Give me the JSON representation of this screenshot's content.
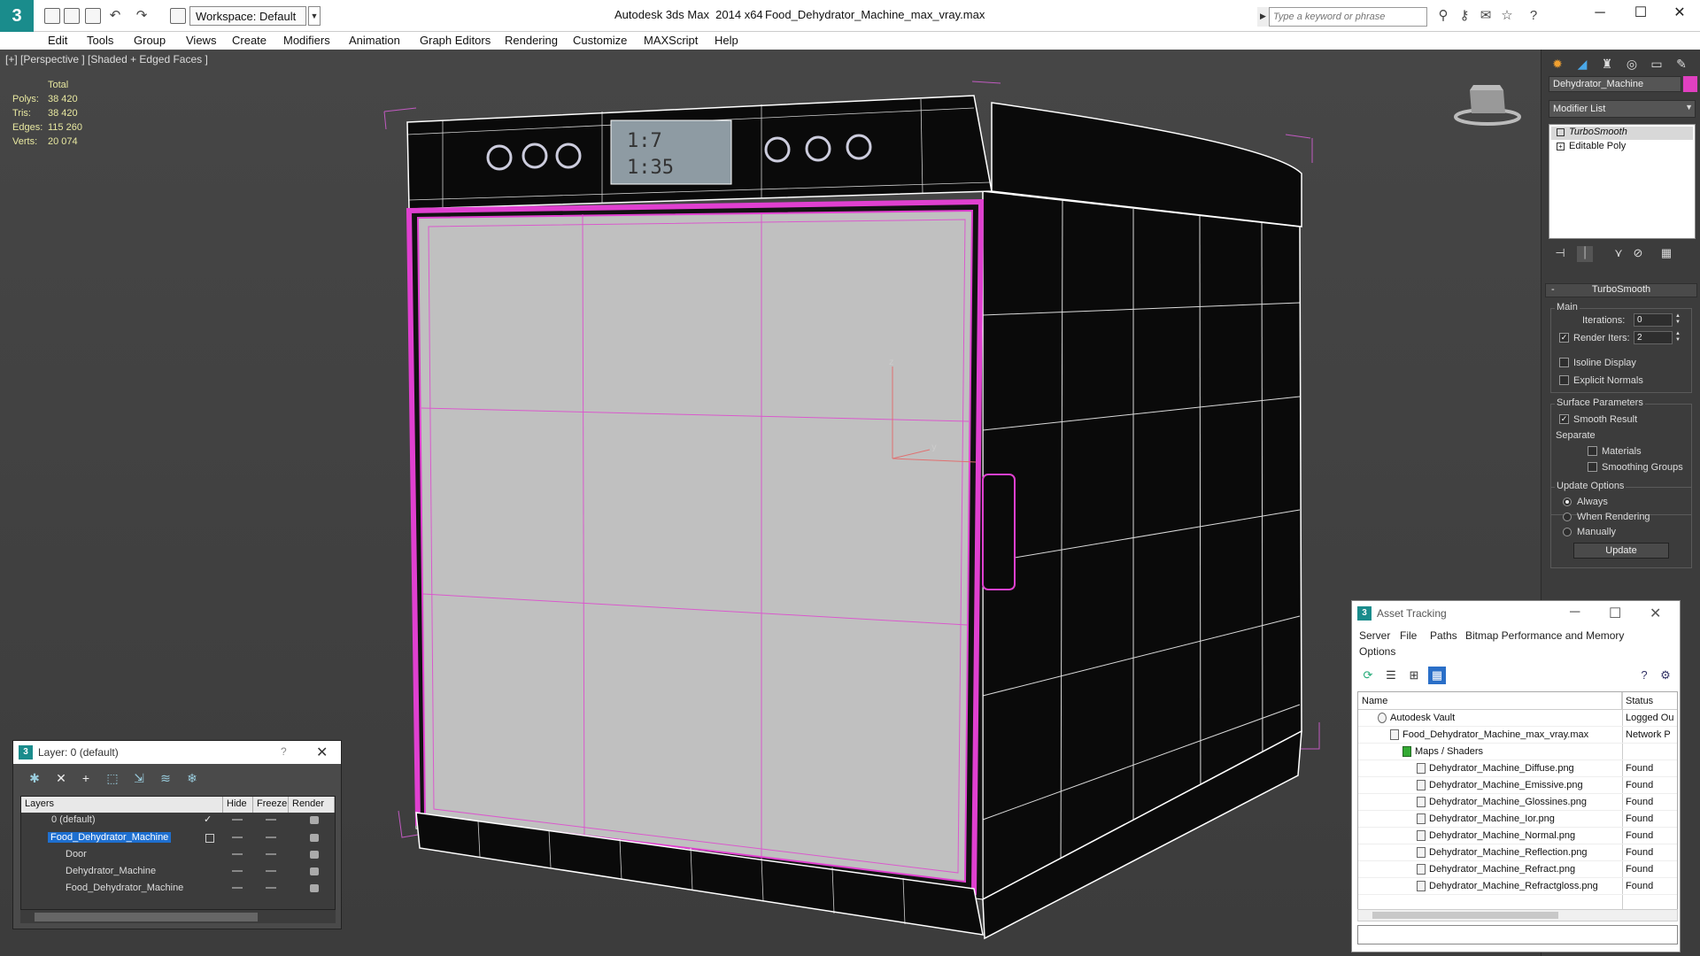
{
  "titlebar": {
    "workspace": "Workspace: Default",
    "app_title": "Autodesk 3ds Max  2014 x64",
    "file_title": "Food_Dehydrator_Machine_max_vray.max",
    "search_placeholder": "Type a keyword or phrase"
  },
  "menu": [
    "Edit",
    "Tools",
    "Group",
    "Views",
    "Create",
    "Modifiers",
    "Animation",
    "Graph Editors",
    "Rendering",
    "Customize",
    "MAXScript",
    "Help"
  ],
  "viewport": {
    "label": "[+] [Perspective ] [Shaded + Edged Faces ]",
    "stats": {
      "header": "Total",
      "rows": [
        {
          "label": "Polys:",
          "value": "38 420"
        },
        {
          "label": "Tris:",
          "value": "38 420"
        },
        {
          "label": "Edges:",
          "value": "115 260"
        },
        {
          "label": "Verts:",
          "value": "20 074"
        }
      ]
    },
    "display": {
      "line1": "1:7",
      "line2": "1:35"
    },
    "axis": {
      "z": "z",
      "y": "y"
    }
  },
  "command_panel": {
    "object_name": "Dehydrator_Machine",
    "object_color": "#e040c0",
    "modifier_list": "Modifier List",
    "stack": [
      "TurboSmooth",
      "Editable Poly"
    ],
    "rollout_title": "TurboSmooth",
    "main_label": "Main",
    "iterations_label": "Iterations:",
    "iterations_value": "0",
    "render_iters_label": "Render Iters:",
    "render_iters_value": "2",
    "isoline_label": "Isoline Display",
    "explicit_normals_label": "Explicit Normals",
    "surface_params_label": "Surface Parameters",
    "smooth_result_label": "Smooth Result",
    "separate_label": "Separate",
    "materials_label": "Materials",
    "smoothing_groups_label": "Smoothing Groups",
    "update_options_label": "Update Options",
    "always_label": "Always",
    "when_rendering_label": "When Rendering",
    "manually_label": "Manually",
    "update_button": "Update"
  },
  "layer_dialog": {
    "title": "Layer: 0 (default)",
    "help": "?",
    "columns": [
      "Layers",
      "Hide",
      "Freeze",
      "Render"
    ],
    "rows": [
      {
        "name": "0 (default)"
      },
      {
        "name": "Food_Dehydrator_Machine"
      },
      {
        "name": "Door"
      },
      {
        "name": "Dehydrator_Machine"
      },
      {
        "name": "Food_Dehydrator_Machine"
      }
    ]
  },
  "asset_tracking": {
    "title": "Asset Tracking",
    "menu": [
      "Server",
      "File",
      "Paths",
      "Bitmap Performance and Memory",
      "Options"
    ],
    "columns": [
      "Name",
      "Status"
    ],
    "rows": [
      {
        "name": "Autodesk Vault",
        "status": "Logged Ou"
      },
      {
        "name": "Food_Dehydrator_Machine_max_vray.max",
        "status": "Network P"
      },
      {
        "name": "Maps / Shaders",
        "status": ""
      },
      {
        "name": "Dehydrator_Machine_Diffuse.png",
        "status": "Found"
      },
      {
        "name": "Dehydrator_Machine_Emissive.png",
        "status": "Found"
      },
      {
        "name": "Dehydrator_Machine_Glossines.png",
        "status": "Found"
      },
      {
        "name": "Dehydrator_Machine_Ior.png",
        "status": "Found"
      },
      {
        "name": "Dehydrator_Machine_Normal.png",
        "status": "Found"
      },
      {
        "name": "Dehydrator_Machine_Reflection.png",
        "status": "Found"
      },
      {
        "name": "Dehydrator_Machine_Refract.png",
        "status": "Found"
      },
      {
        "name": "Dehydrator_Machine_Refractgloss.png",
        "status": "Found"
      }
    ]
  }
}
